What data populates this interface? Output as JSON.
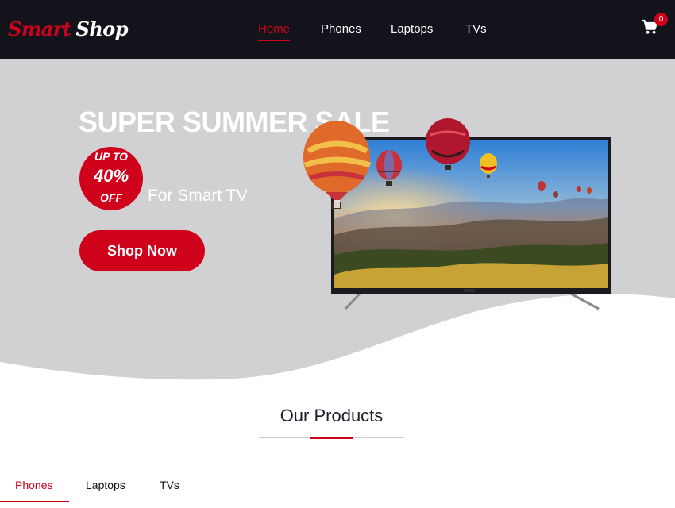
{
  "brand": {
    "part1": "Smart",
    "part2": "Shop"
  },
  "nav": {
    "links": [
      {
        "label": "Home",
        "active": true
      },
      {
        "label": "Phones",
        "active": false
      },
      {
        "label": "Laptops",
        "active": false
      },
      {
        "label": "TVs",
        "active": false
      }
    ],
    "cart_count": "0",
    "cart_icon": "cart-icon"
  },
  "hero": {
    "title": "SUPER SUMMER SALE",
    "badge": {
      "line1": "UP TO",
      "line2": "40%",
      "line3": "OFF"
    },
    "subtitle": "For Smart TV",
    "cta": "Shop Now"
  },
  "products": {
    "title": "Our Products",
    "tabs": [
      {
        "label": "Phones",
        "active": true
      },
      {
        "label": "Laptops",
        "active": false
      },
      {
        "label": "TVs",
        "active": false
      }
    ]
  },
  "colors": {
    "accent": "#d0021b",
    "nav_bg": "#13131c",
    "hero_bg": "#d1d1d3",
    "text_dark": "#1d1d2b"
  }
}
